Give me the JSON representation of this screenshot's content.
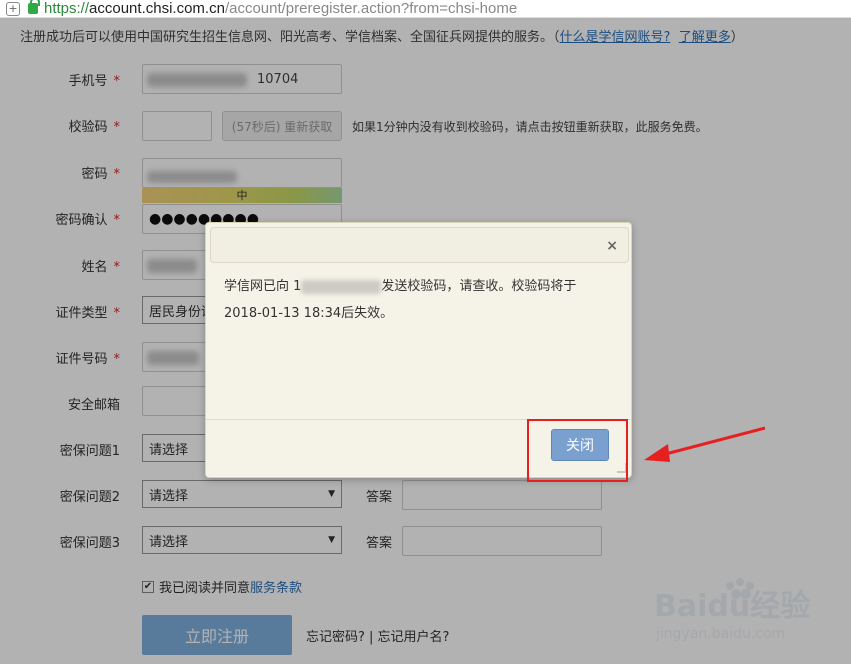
{
  "browser": {
    "url_protocol": "https://",
    "url_host": "account.chsi.com.cn",
    "url_path": "/account/preregister.action?from=chsi-home"
  },
  "form": {
    "notice": "注册成功后可以使用中国研究生招生信息网、阳光高考、学信档案、全国征兵网提供的服务。（",
    "notice_link1": "什么是学信网账号?",
    "notice_link2": "了解更多",
    "notice_end": "）",
    "fields": {
      "phone_label": "手机号",
      "phone_value": "10704",
      "code_label": "校验码",
      "resend_label": "(57秒后) 重新获取",
      "code_hint": "如果1分钟内没有收到校验码，请点击按钮重新获取，此服务免费。",
      "password_label": "密码",
      "strength_label": "中",
      "confirm_label": "密码确认",
      "confirm_value": "●●●●●●●●●",
      "name_label": "姓名",
      "idtype_label": "证件类型",
      "idtype_value": "居民身份证",
      "idnum_label": "证件号码",
      "idnum_value": "1",
      "email_label": "安全邮箱",
      "q1_label": "密保问题1",
      "q1_value": "请选择",
      "q2_label": "密保问题2",
      "q2_value": "请选择",
      "q3_label": "密保问题3",
      "q3_value": "请选择",
      "answer_label": "答案",
      "required_mark": "*"
    },
    "agree_text": "我已阅读并同意",
    "agree_link": "服务条款",
    "checkbox_mark": "✔",
    "register_label": "立即注册",
    "forgot_text": "忘记密码? | 忘记用户名?"
  },
  "dialog": {
    "close_icon": "×",
    "message_part1": "学信网已向 1",
    "message_part2": "发送校验码，请查收。校验码将于",
    "message_line2": "2018-01-13 18:34后失效。",
    "close_button": "关闭"
  },
  "watermark": {
    "brand": "Baidu经验",
    "site": "jingyan.baidu.com"
  },
  "colors": {
    "annotation": "#e62020",
    "link": "#2a6fb8",
    "dialog_button": "#7aa0cf"
  }
}
